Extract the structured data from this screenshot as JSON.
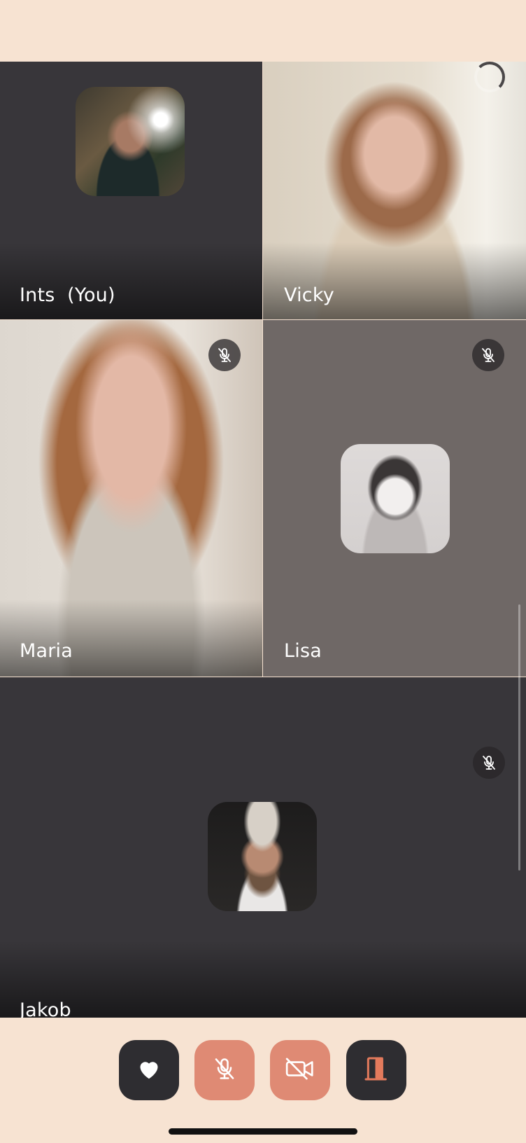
{
  "participants": [
    {
      "name": "Ints",
      "suffix": "(You)",
      "muted": false,
      "video_on": false
    },
    {
      "name": "Vicky",
      "muted": false,
      "video_on": true
    },
    {
      "name": "Maria",
      "muted": true,
      "video_on": true
    },
    {
      "name": "Lisa",
      "muted": true,
      "video_on": false
    },
    {
      "name": "Jakob",
      "muted": true,
      "video_on": false
    }
  ],
  "controls": {
    "reaction_icon": "heart-icon",
    "mic_icon": "mic-off-icon",
    "camera_icon": "camera-off-icon",
    "leave_icon": "door-exit-icon"
  },
  "colors": {
    "background": "#f7e3d2",
    "tile_dark": "#38363a",
    "button_dark": "#2e2d31",
    "button_coral": "#df8a74",
    "leave_accent": "#e37a5c"
  }
}
